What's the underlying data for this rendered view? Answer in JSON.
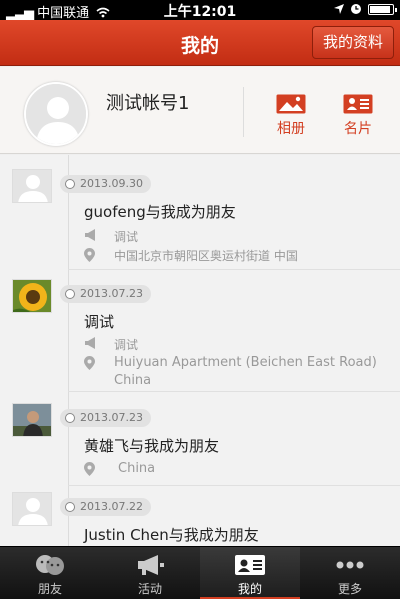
{
  "status_bar": {
    "carrier": "中国联通",
    "time": "上午12:01"
  },
  "nav": {
    "title": "我的",
    "profile_button": "我的资料"
  },
  "profile": {
    "username": "测试帐号1",
    "album_label": "相册",
    "card_label": "名片",
    "album_icon": "photo-icon",
    "card_icon": "id-card-icon"
  },
  "timeline": [
    {
      "date": "2013.09.30",
      "text": "guofeng与我成为朋友",
      "tag": "调试",
      "location": "中国北京市朝阳区奥运村街道 中国",
      "location2": "",
      "avatar": "default-avatar"
    },
    {
      "date": "2013.07.23",
      "text": "调试",
      "tag": "调试",
      "location": "Huiyuan Apartment (Beichen East Road)",
      "location2": "China",
      "avatar": "sunflower-photo"
    },
    {
      "date": "2013.07.23",
      "text": "黄雄飞与我成为朋友",
      "tag": "",
      "location": "China",
      "location2": "",
      "avatar": "person-photo"
    },
    {
      "date": "2013.07.22",
      "text": "Justin Chen与我成为朋友",
      "tag": "",
      "location": "",
      "location2": "",
      "avatar": "default-avatar"
    }
  ],
  "tabs": [
    {
      "label": "朋友",
      "icon": "friends-icon",
      "active": false
    },
    {
      "label": "活动",
      "icon": "megaphone-icon",
      "active": false
    },
    {
      "label": "我的",
      "icon": "profile-card-icon",
      "active": true
    },
    {
      "label": "更多",
      "icon": "more-icon",
      "active": false
    }
  ],
  "colors": {
    "accent": "#d33f22",
    "nav_top": "#e0482a",
    "nav_bottom": "#c22d13",
    "tabbar": "#1a1a1a"
  }
}
